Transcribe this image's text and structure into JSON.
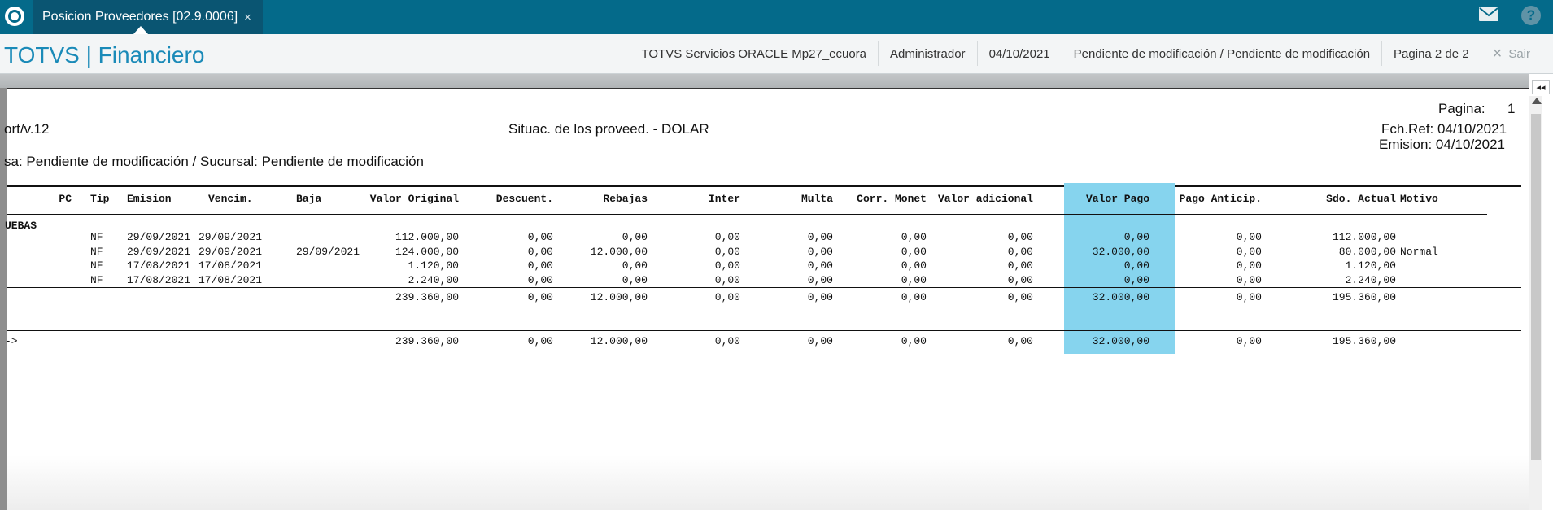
{
  "topbar": {
    "tab_label": "Posicion Proveedores [02.9.0006]",
    "tab_close": "×",
    "help_label": "?"
  },
  "header": {
    "title": "TOTVS | Financiero",
    "environment": "TOTVS Servicios ORACLE Mp27_ecuora",
    "user": "Administrador",
    "date": "04/10/2021",
    "company": "Pendiente de modificación / Pendiente de modificación",
    "page": "Pagina 2 de 2",
    "exit_icon": "×",
    "exit_label": "Sair"
  },
  "report": {
    "program": "ort/v.12",
    "title": "Situac. de los proveed. - DOLAR",
    "page_label": "Pagina:",
    "page_number": "1",
    "ref_date": "Fch.Ref: 04/10/2021",
    "emission": "Emision: 04/10/2021",
    "filter": "sa: Pendiente de modificación / Sucursal: Pendiente de modificación",
    "columns": [
      "PC",
      "Tip",
      "Emision",
      "Vencim.",
      "Baja",
      "Valor Original",
      "Descuent.",
      "Rebajas",
      "Inter",
      "Multa",
      "Corr. Monet",
      "Valor adicional",
      "Valor Pago",
      "Pago Anticip.",
      "Sdo. Actual",
      "Motivo"
    ],
    "group_label": "UEBAS",
    "rows": [
      [
        "",
        "NF",
        "29/09/2021",
        "29/09/2021",
        "",
        "112.000,00",
        "0,00",
        "0,00",
        "0,00",
        "0,00",
        "0,00",
        "0,00",
        "0,00",
        "0,00",
        "112.000,00",
        ""
      ],
      [
        "",
        "NF",
        "29/09/2021",
        "29/09/2021",
        "29/09/2021",
        "124.000,00",
        "0,00",
        "12.000,00",
        "0,00",
        "0,00",
        "0,00",
        "0,00",
        "32.000,00",
        "0,00",
        "80.000,00",
        "Normal"
      ],
      [
        "",
        "NF",
        "17/08/2021",
        "17/08/2021",
        "",
        "1.120,00",
        "0,00",
        "0,00",
        "0,00",
        "0,00",
        "0,00",
        "0,00",
        "0,00",
        "0,00",
        "1.120,00",
        ""
      ],
      [
        "",
        "NF",
        "17/08/2021",
        "17/08/2021",
        "",
        "2.240,00",
        "0,00",
        "0,00",
        "0,00",
        "0,00",
        "0,00",
        "0,00",
        "0,00",
        "0,00",
        "2.240,00",
        ""
      ]
    ],
    "subtotal": [
      "",
      "",
      "",
      "",
      "",
      "239.360,00",
      "0,00",
      "12.000,00",
      "0,00",
      "0,00",
      "0,00",
      "0,00",
      "32.000,00",
      "0,00",
      "195.360,00",
      ""
    ],
    "total_label": "->",
    "total": [
      "",
      "",
      "",
      "",
      "",
      "239.360,00",
      "0,00",
      "12.000,00",
      "0,00",
      "0,00",
      "0,00",
      "0,00",
      "32.000,00",
      "0,00",
      "195.360,00",
      ""
    ],
    "highlight_color": "#86d4ee"
  }
}
